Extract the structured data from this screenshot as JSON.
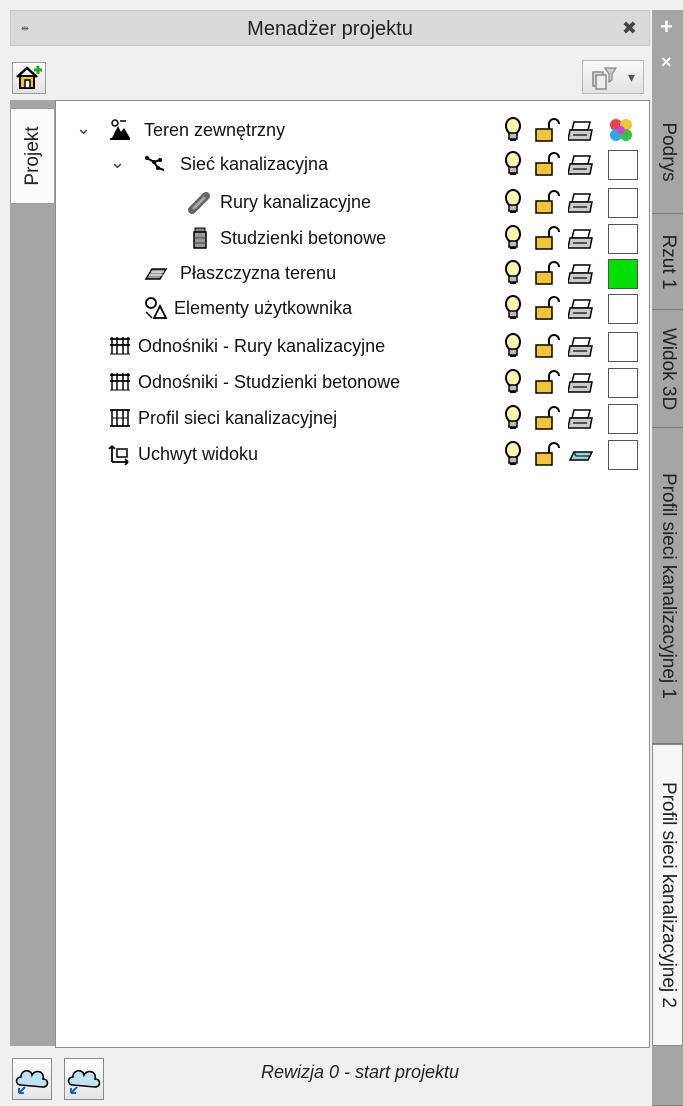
{
  "window": {
    "title": "Menadżer projektu",
    "pin_glyph": "⇹",
    "close_glyph": "✖"
  },
  "toolbar": {
    "add_button_icon": "house-add-icon",
    "filter_button_icon": "layers-filter-icon",
    "filter_dropdown_glyph": "▾"
  },
  "left_tabs": [
    {
      "label": "Projekt",
      "active": true
    }
  ],
  "tree": {
    "rows": [
      {
        "label": "Teren zewnętrzny",
        "level": 0,
        "expanded": true,
        "icon": "terrain-icon",
        "print_icon": "printer-icon",
        "color_icon": "multicolor-icon",
        "color": ""
      },
      {
        "label": "Sieć kanalizacyjna",
        "level": 1,
        "expanded": true,
        "icon": "network-icon",
        "print_icon": "printer-icon",
        "color": "#ffffff"
      },
      {
        "label": "Rury kanalizacyjne",
        "level": 2,
        "icon": "pipe-icon",
        "print_icon": "printer-icon",
        "color": "#ffffff"
      },
      {
        "label": "Studzienki betonowe",
        "level": 2,
        "icon": "manhole-icon",
        "print_icon": "printer-icon",
        "color": "#ffffff"
      },
      {
        "label": "Płaszczyzna terenu",
        "level": 1,
        "icon": "terrain-plane-icon",
        "print_icon": "printer-icon",
        "color": "#00e000"
      },
      {
        "label": "Elementy użytkownika",
        "level": 1,
        "icon": "user-elements-icon",
        "print_icon": "printer-icon",
        "color": "#ffffff"
      },
      {
        "label": "Odnośniki - Rury kanalizacyjne",
        "level": 0,
        "icon": "leader-table-icon",
        "print_icon": "printer-icon",
        "color": "#ffffff"
      },
      {
        "label": "Odnośniki - Studzienki betonowe",
        "level": 0,
        "icon": "leader-table-icon",
        "print_icon": "printer-icon",
        "color": "#ffffff"
      },
      {
        "label": "Profil sieci kanalizacyjnej",
        "level": 0,
        "icon": "profile-icon",
        "print_icon": "printer-icon",
        "color": "#ffffff"
      },
      {
        "label": "Uchwyt widoku",
        "level": 0,
        "icon": "view-handle-icon",
        "print_icon": "eraser-icon",
        "color": "#ffffff"
      }
    ]
  },
  "right_tabs": [
    {
      "label": "Podrys",
      "active": false
    },
    {
      "label": "Rzut 1",
      "active": false
    },
    {
      "label": "Widok 3D",
      "active": false
    },
    {
      "label": "Profil sieci kanalizacyjnej 1",
      "active": false
    },
    {
      "label": "Profil sieci kanalizacyjnej 2",
      "active": true
    }
  ],
  "right_header": {
    "plus_glyph": "+",
    "close_glyph": "×"
  },
  "status": {
    "revision": "Rewizja 0 - start projektu",
    "buttons": [
      "cloud-revision-icon",
      "cloud-revision-icon"
    ]
  }
}
